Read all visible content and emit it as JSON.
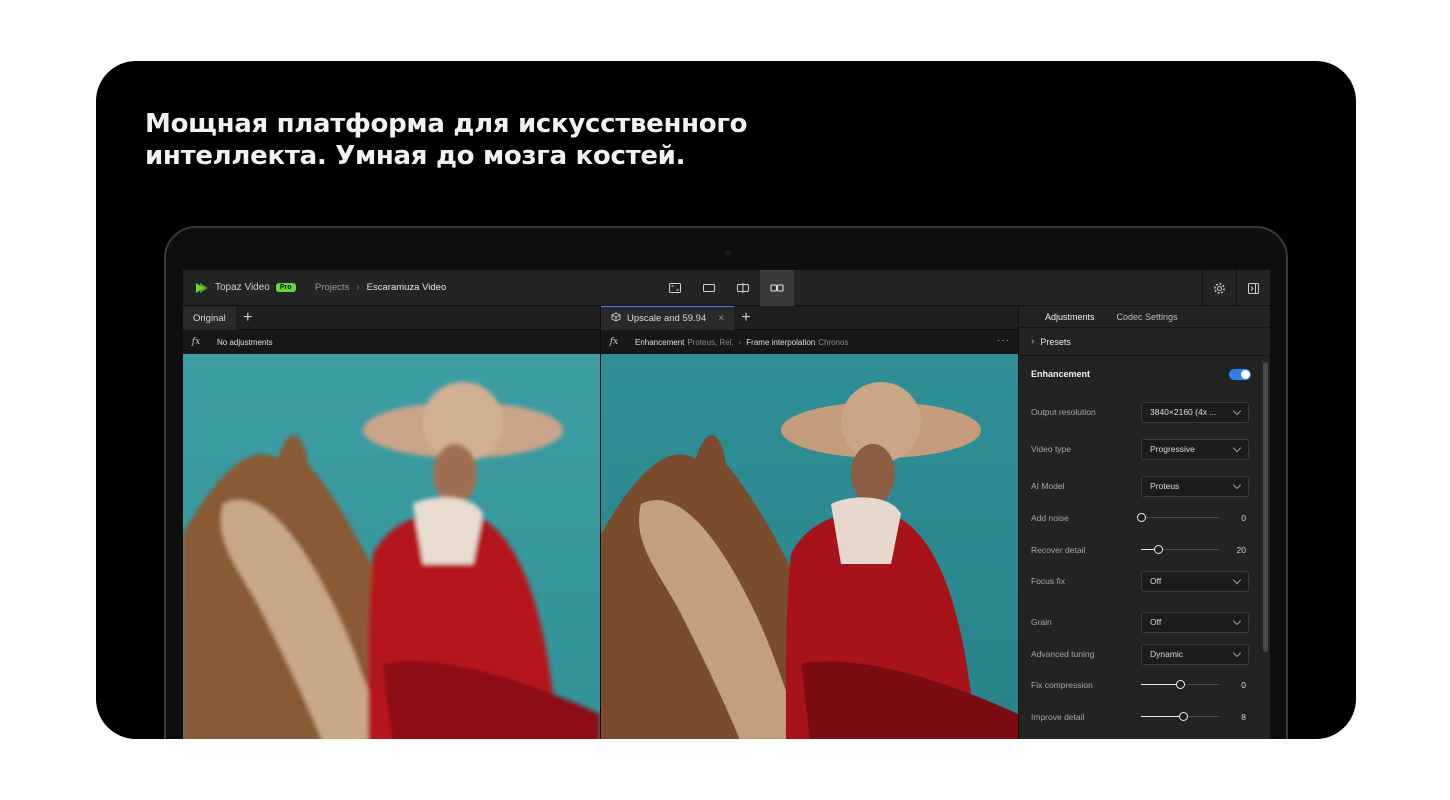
{
  "headline": "Мощная платформа для искусственного интеллекта. Умная до мозга костей.",
  "app": {
    "name": "Topaz Video",
    "badge": "Pro",
    "brand_color": "#6ad43b",
    "accent_color": "#2f80ed"
  },
  "breadcrumb": {
    "projects": "Projects",
    "separator": "›",
    "current": "Escaramuza Video"
  },
  "view_modes": [
    {
      "icon": "crop-view-icon",
      "active": false
    },
    {
      "icon": "single-view-icon",
      "active": false
    },
    {
      "icon": "split-view-icon",
      "active": false
    },
    {
      "icon": "side-by-side-view-icon",
      "active": true
    }
  ],
  "toolbar_right": [
    "settings-gear-icon",
    "toggle-panel-icon"
  ],
  "left_viewer": {
    "tab_label": "Original",
    "fx_label": "fx",
    "adjustments_text": "No adjustments"
  },
  "right_viewer": {
    "tab_label": "Upscale and 59.94",
    "fx_label": "fx",
    "filters": [
      {
        "name": "Enhancement",
        "detail": "Proteus, Rel."
      },
      {
        "name": "Frame interpolation",
        "detail": "Chronos"
      }
    ],
    "more": "···"
  },
  "panel": {
    "tabs": [
      "Adjustments",
      "Codec Settings"
    ],
    "presets_label": "Presets",
    "section_title": "Enhancement",
    "enabled": true,
    "output_resolution": {
      "label": "Output resolution",
      "value": "3840×2160 (4x ..."
    },
    "video_type": {
      "label": "Video type",
      "value": "Progressive"
    },
    "ai_model": {
      "label": "AI Model",
      "value": "Proteus"
    },
    "add_noise": {
      "label": "Add noise",
      "value": "0",
      "fraction": 0.0
    },
    "recover_detail": {
      "label": "Recover detail",
      "value": "20",
      "fraction": 0.22
    },
    "focus_fix": {
      "label": "Focus fix",
      "value": "Off"
    },
    "grain": {
      "label": "Grain",
      "value": "Off"
    },
    "advanced_tuning": {
      "label": "Advanced tuning",
      "value": "Dynamic"
    },
    "fix_compression": {
      "label": "Fix compression",
      "value": "0",
      "fraction": 0.5
    },
    "improve_detail": {
      "label": "Improve detail",
      "value": "8",
      "fraction": 0.54
    }
  }
}
